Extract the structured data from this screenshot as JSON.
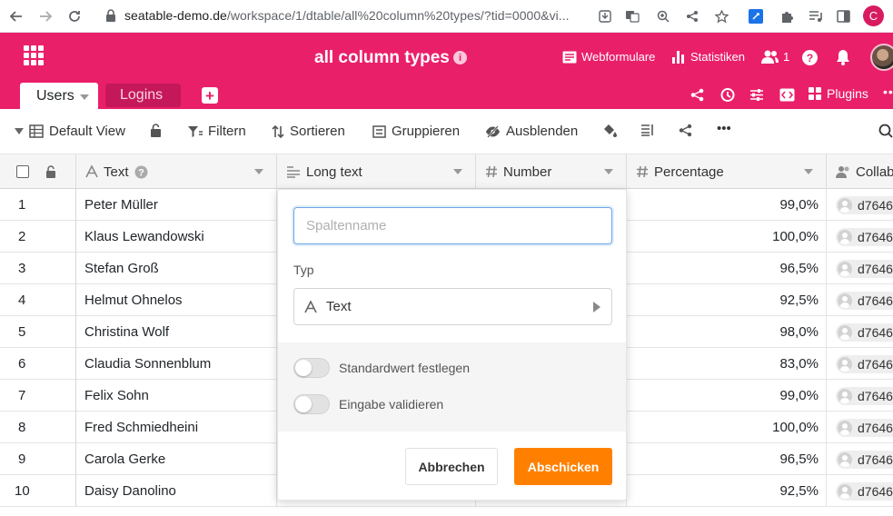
{
  "browser": {
    "url_domain": "seatable-demo.de",
    "url_path": "/workspace/1/dtable/all%20column%20types/?tid=0000&vi...",
    "profile_initial": "C"
  },
  "header": {
    "base_title": "all column types",
    "webformulare_label": "Webformulare",
    "statistiken_label": "Statistiken",
    "collaborator_count": "1",
    "help_label": "?"
  },
  "tables": {
    "active_tab": "Users",
    "other_tab": "Logins",
    "add_label": "+",
    "plugins_label": "Plugins",
    "more_label": "••"
  },
  "toolbar": {
    "view_name": "Default View",
    "filter_label": "Filtern",
    "sort_label": "Sortieren",
    "group_label": "Gruppieren",
    "hide_label": "Ausblenden",
    "more_label": "•••"
  },
  "columns": [
    {
      "name": "Text",
      "icon": "text-type-icon"
    },
    {
      "name": "Long text",
      "icon": "long-text-type-icon"
    },
    {
      "name": "Number",
      "icon": "number-type-icon"
    },
    {
      "name": "Percentage",
      "icon": "number-type-icon"
    },
    {
      "name": "Collab",
      "icon": "collaborator-type-icon"
    }
  ],
  "rows": [
    {
      "index": "1",
      "text": "Peter Müller",
      "percentage": "99,0%",
      "collaborator": "d7646"
    },
    {
      "index": "2",
      "text": "Klaus Lewandowski",
      "percentage": "100,0%",
      "collaborator": "d7646"
    },
    {
      "index": "3",
      "text": "Stefan Groß",
      "percentage": "96,5%",
      "collaborator": "d7646"
    },
    {
      "index": "4",
      "text": "Helmut Ohnelos",
      "percentage": "92,5%",
      "collaborator": "d7646"
    },
    {
      "index": "5",
      "text": "Christina Wolf",
      "percentage": "98,0%",
      "collaborator": "d7646"
    },
    {
      "index": "6",
      "text": "Claudia Sonnenblum",
      "percentage": "83,0%",
      "collaborator": "d7646"
    },
    {
      "index": "7",
      "text": "Felix Sohn",
      "percentage": "99,0%",
      "collaborator": "d7646"
    },
    {
      "index": "8",
      "text": "Fred Schmiedheini",
      "percentage": "100,0%",
      "collaborator": "d7646"
    },
    {
      "index": "9",
      "text": "Carola Gerke",
      "percentage": "96,5%",
      "collaborator": "d7646"
    },
    {
      "index": "10",
      "text": "Daisy Danolino",
      "percentage": "92,5%",
      "collaborator": "d7646"
    }
  ],
  "new_column_dialog": {
    "name_placeholder": "Spaltenname",
    "name_value": "",
    "type_label": "Typ",
    "type_value": "Text",
    "default_value_label": "Standardwert festlegen",
    "default_value_enabled": false,
    "validate_label": "Eingabe validieren",
    "validate_enabled": false,
    "cancel_label": "Abbrechen",
    "submit_label": "Abschicken"
  },
  "colors": {
    "brand": "#ea1f6a",
    "submit": "#ff8000",
    "input_focus": "#6aa8e8"
  }
}
